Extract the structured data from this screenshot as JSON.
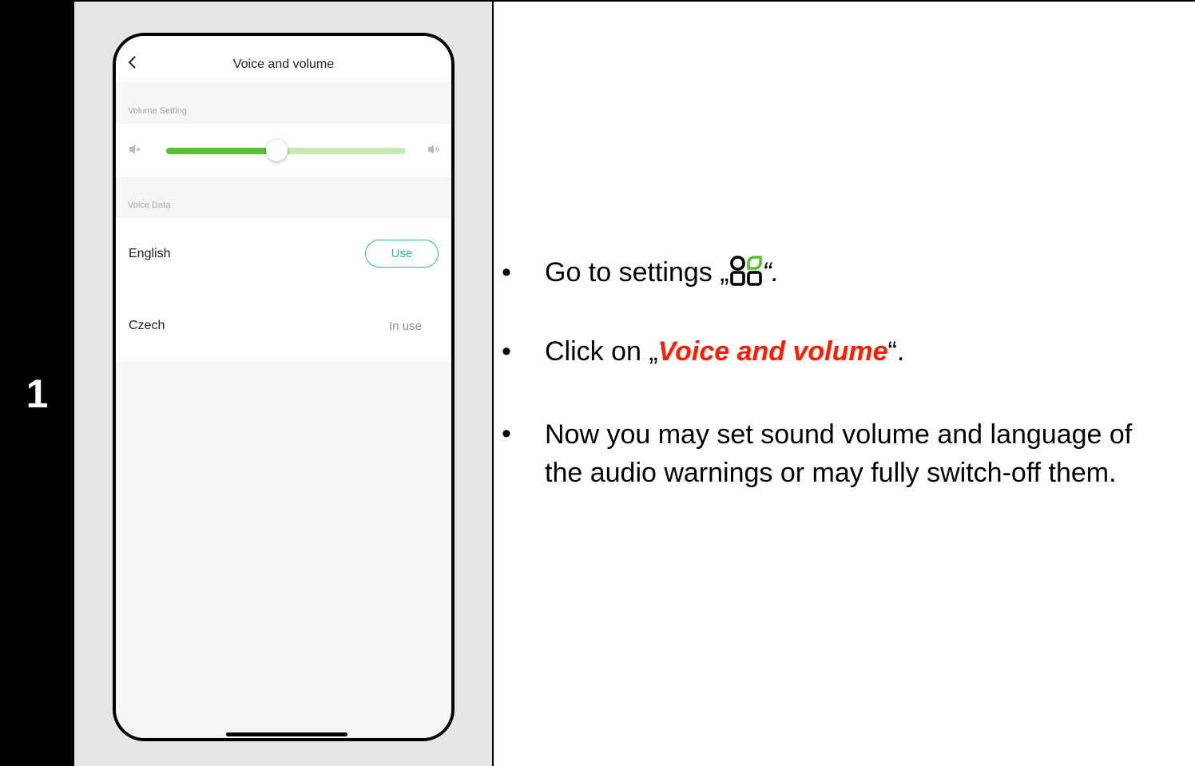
{
  "step": {
    "number": "1"
  },
  "app": {
    "title": "Voice and volume",
    "volume_section_label": "Volume Setting",
    "volume_level": 0.46,
    "voice_section_label": "Voice Data",
    "languages": [
      {
        "name": "English",
        "action_label": "Use"
      },
      {
        "name": "Czech",
        "status_label": "In use"
      }
    ],
    "colors": {
      "accent": "#58c130",
      "accent_light": "#c7eab2",
      "button": "#29b9ab"
    },
    "icons": [
      "back-icon",
      "mute-icon",
      "volume-icon"
    ]
  },
  "instructions": {
    "line1_prefix": "Go to settings „",
    "line1_suffix": "“.",
    "line1_icon": "settings-grid-icon",
    "line2_prefix": "Click on „",
    "line2_highlight": "Voice and volume",
    "line2_suffix": "“.",
    "line3": "Now you may set sound volume and language of the audio warnings or may fully switch-off them.",
    "bullet": "•",
    "highlight_color": "#ff1a00"
  }
}
